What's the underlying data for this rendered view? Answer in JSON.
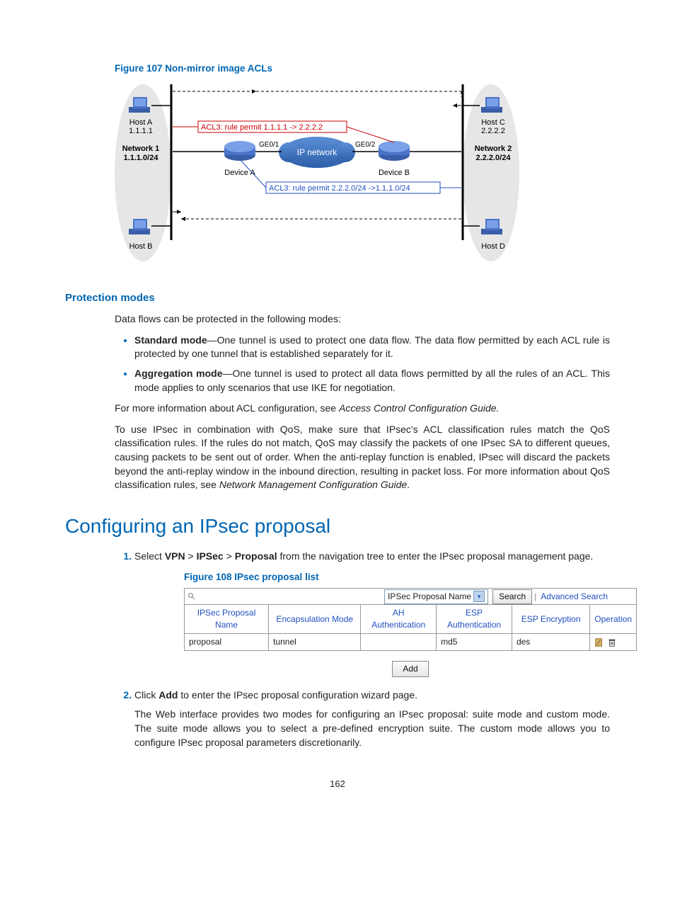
{
  "figure107": {
    "caption": "Figure 107 Non-mirror image ACLs",
    "hostA": "Host A",
    "hostA_ip": "1.1.1.1",
    "network1": "Network 1",
    "network1_sub": "1.1.1.0/24",
    "hostB": "Host B",
    "ge01": "GE0/1",
    "ge02": "GE0/2",
    "deviceA": "Device A",
    "deviceB": "Device B",
    "ipnet": "IP network",
    "acl_top": "ACL3: rule permit 1.1.1.1 -> 2.2.2.2",
    "acl_bottom": "ACL3: rule permit 2.2.2.0/24 ->1.1.1.0/24",
    "hostC": "Host C",
    "hostC_ip": "2.2.2.2",
    "network2": "Network 2",
    "network2_sub": "2.2.2.0/24",
    "hostD": "Host D"
  },
  "protection": {
    "heading": "Protection modes",
    "intro": "Data flows can be protected in the following modes:",
    "std_bold": "Standard mode",
    "std_text": "—One tunnel is used to protect one data flow. The data flow permitted by each ACL rule is protected by one tunnel that is established separately for it.",
    "agg_bold": "Aggregation mode",
    "agg_text": "—One tunnel is used to protect all data flows permitted by all the rules of an ACL. This mode applies to only scenarios that use IKE for negotiation.",
    "para_more_pre": "For more information about ACL configuration, see ",
    "para_more_ital": "Access Control Configuration Guide.",
    "para_qos_pre": "To use IPsec in combination with QoS, make sure that IPsec's ACL classification rules match the QoS classification rules. If the rules do not match, QoS may classify the packets of one IPsec SA to different queues, causing packets to be sent out of order. When the anti-replay function is enabled, IPsec will discard the packets beyond the anti-replay window in the inbound direction, resulting in packet loss. For more information about QoS classification rules, see ",
    "para_qos_ital": "Network Management Configuration Guide",
    "para_qos_post": "."
  },
  "config": {
    "heading": "Configuring an IPsec proposal",
    "step1_pre": "Select ",
    "step1_vpn": "VPN",
    "step1_ipsec": "IPSec",
    "step1_proposal": "Proposal",
    "step1_post": " from the navigation tree to enter the IPsec proposal management page.",
    "figure108_caption": "Figure 108 IPsec proposal list",
    "search_select": "IPSec Proposal Name",
    "search_btn": "Search",
    "adv_search": "Advanced Search",
    "th_name": "IPSec Proposal Name",
    "th_encap": "Encapsulation Mode",
    "th_ah": "AH Authentication",
    "th_esp_auth": "ESP Authentication",
    "th_esp_enc": "ESP Encryption",
    "th_op": "Operation",
    "row_name": "proposal",
    "row_encap": "tunnel",
    "row_ah": "",
    "row_esp_auth": "md5",
    "row_esp_enc": "des",
    "add_btn": "Add",
    "step2_pre": "Click ",
    "step2_bold": "Add",
    "step2_post": " to enter the IPsec proposal configuration wizard page.",
    "step2_p2": "The Web interface provides two modes for configuring an IPsec proposal: suite mode and custom mode. The suite mode allows you to select a pre-defined encryption suite. The custom mode allows you to configure IPsec proposal parameters discretionarily."
  },
  "page_number": "162"
}
